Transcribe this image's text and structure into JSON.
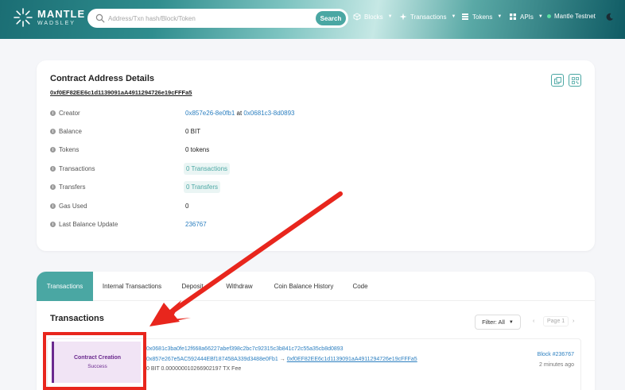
{
  "header": {
    "logo_title": "MANTLE",
    "logo_sub": "WADSLEY",
    "search_placeholder": "Address/Txn hash/Block/Token",
    "search_button": "Search",
    "nav": [
      {
        "label": "Blocks",
        "icon": "blocks-icon"
      },
      {
        "label": "Transactions",
        "icon": "transactions-icon"
      },
      {
        "label": "Tokens",
        "icon": "tokens-icon"
      },
      {
        "label": "APIs",
        "icon": "apis-icon"
      }
    ],
    "network": "Mantle Testnet",
    "theme_icon": "moon-icon"
  },
  "contract": {
    "title": "Contract Address Details",
    "address": "0xf0EF82EE6c1d1139091aA4911294726e19cFFFa5",
    "rows": [
      {
        "label": "Creator",
        "value_a": "0x857e26-8e0fb1",
        "value_mid": " at ",
        "value_b": "0x0681c3-8d0893"
      },
      {
        "label": "Balance",
        "value": "0 BIT"
      },
      {
        "label": "Tokens",
        "value": "0 tokens"
      },
      {
        "label": "Transactions",
        "value": "0 Transactions"
      },
      {
        "label": "Transfers",
        "value": "0 Transfers"
      },
      {
        "label": "Gas Used",
        "value": "0"
      },
      {
        "label": "Last Balance Update",
        "value": "236767"
      }
    ]
  },
  "tabs": [
    "Transactions",
    "Internal Transactions",
    "Deposit",
    "Withdraw",
    "Coin Balance History",
    "Code"
  ],
  "transactions": {
    "title": "Transactions",
    "filter": "Filter: All",
    "page": "Page 1",
    "item": {
      "type": "Contract Creation",
      "status": "Success",
      "hash": "0x0681c3ba0fe12f668a66227abef398c2bc7c92315c3b841c72c55a35cb8d0893",
      "from": "0x857e267e5AC592444EBf187458A339d3488e0Fb1",
      "arrow": " → ",
      "to": "0xf0EF82EE6c1d1139091aA4911294726e19cFFFa5",
      "fee": "0 BIT 0.000000010266902197 TX Fee",
      "block": "Block #236767",
      "time": "2 minutes ago"
    }
  },
  "colors": {
    "accent": "#4aa7a3",
    "link": "#2c7fc0",
    "annotation": "#e8261d"
  }
}
